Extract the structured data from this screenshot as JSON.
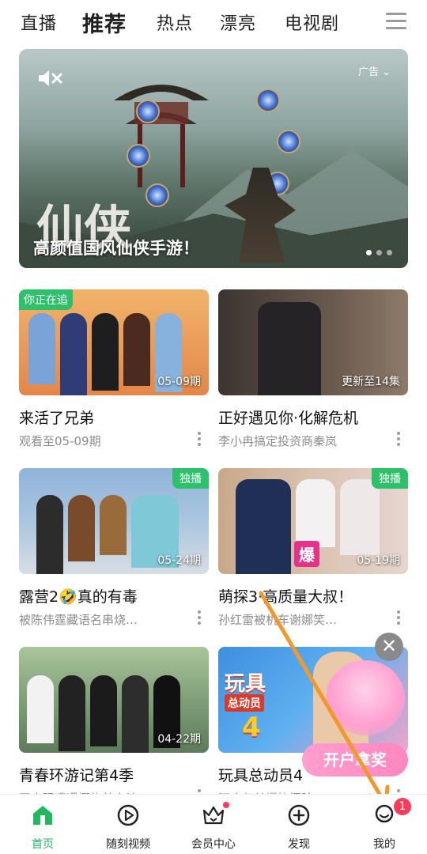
{
  "top_tabs": [
    "直播",
    "推荐",
    "热点",
    "漂亮",
    "电视剧"
  ],
  "banner": {
    "caption": "高颜值国风仙侠手游！",
    "ad_label": "广告",
    "logo_text": "仙侠"
  },
  "cards": [
    {
      "title": "来活了兄弟",
      "subtitle": "观看至05-09期",
      "episode": "05-09期",
      "badge": "你正在追"
    },
    {
      "title": "正好遇见你·化解危机",
      "subtitle": "李小冉搞定投资商秦岚",
      "episode": "更新至14集",
      "badge": ""
    },
    {
      "title": "露营2🤣真的有毒",
      "subtitle": "被陈伟霆藏语名串烧…",
      "episode": "05-24期",
      "badge": "独播"
    },
    {
      "title": "萌探3·高质量大叔！",
      "subtitle": "孙红雷被机车谢娜笑…",
      "episode": "05-19期",
      "badge": "独播"
    },
    {
      "title": "青春环游记第4季",
      "subtitle": "王宝强遭遇挪扎美人计",
      "episode": "04-22期",
      "badge": ""
    },
    {
      "title": "玩具总动员4",
      "subtitle": "汪康归兑爆笑探险",
      "episode": "",
      "badge": "",
      "poster_title": "玩具",
      "poster_sub": "总动员",
      "poster_num": "4"
    }
  ],
  "floating": {
    "promo_button": "开户拿奖",
    "close_symbol": "✕"
  },
  "bottom_nav": [
    {
      "label": "首页",
      "icon": "home-icon"
    },
    {
      "label": "随刻视频",
      "icon": "play-circle-icon"
    },
    {
      "label": "会员中心",
      "icon": "crown-icon"
    },
    {
      "label": "发现",
      "icon": "plus-circle-icon"
    },
    {
      "label": "我的",
      "icon": "user-icon"
    }
  ],
  "notification_count": "1",
  "colors": {
    "accent": "#22b860",
    "badge": "#2ec16b",
    "promo": "#ff86c0"
  }
}
